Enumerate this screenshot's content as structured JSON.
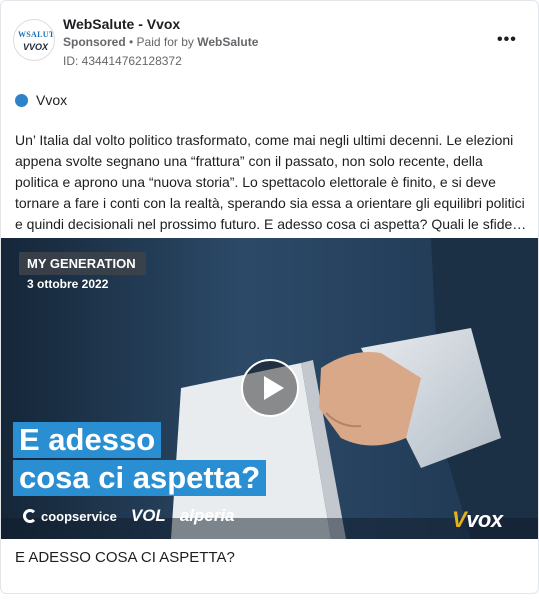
{
  "post": {
    "page_name": "WebSalute - Vvox",
    "sponsored": "Sponsored",
    "paid_for": "• Paid for by",
    "payer": "WebSalute",
    "ad_id": "ID: 434414762128372",
    "more": "•••",
    "avatar_line1": "WSALUTE",
    "avatar_line2": "VVOX"
  },
  "platform": {
    "name": "Vvox",
    "icon": "dot-icon",
    "color": "#2e82c7"
  },
  "body": "Un’ Italia dal volto politico trasformato, come mai negli ultimi decenni. Le elezioni appena svolte segnano una “frattura” con il passato, non solo recente, della politica e aprono una “nuova storia”. Lo spettacolo elettorale è finito, e si deve tornare a fare i conti con la realtà, sperando sia essa a orientare gli equilibri politici e quindi decisionali nel prossimo futuro. E adesso cosa ci aspetta? Quali le sfide…",
  "media": {
    "label": "MY GENERATION",
    "date": "3 ottobre 2022",
    "headline_line1": "E adesso",
    "headline_line2": "cosa ci aspetta?",
    "logo_coop": "coopservice",
    "logo_vol": "VOL",
    "logo_alperia": "alperia",
    "logo_vvox_v": "V",
    "logo_vvox_rest": "vox",
    "accent": "#2a8fd2"
  },
  "caption": "E ADESSO COSA CI ASPETTA?"
}
